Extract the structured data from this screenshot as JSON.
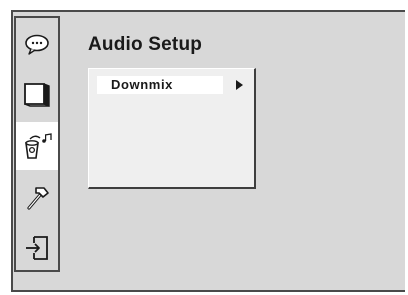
{
  "screen": {
    "title": "Audio Setup"
  },
  "sidebar": {
    "items": [
      {
        "icon": "speech-bubble-icon",
        "active": false
      },
      {
        "icon": "tv-screen-icon",
        "active": false
      },
      {
        "icon": "speaker-music-icon",
        "active": true
      },
      {
        "icon": "hammer-icon",
        "active": false
      },
      {
        "icon": "exit-door-icon",
        "active": false
      }
    ]
  },
  "menu": {
    "items": [
      {
        "label": "Downmix",
        "has_submenu": true,
        "selected": true
      }
    ]
  },
  "colors": {
    "background": "#d8d8d8",
    "panel": "#efefef",
    "highlight": "#ffffff",
    "text": "#1a1a1a",
    "border": "#4a4a4a"
  }
}
